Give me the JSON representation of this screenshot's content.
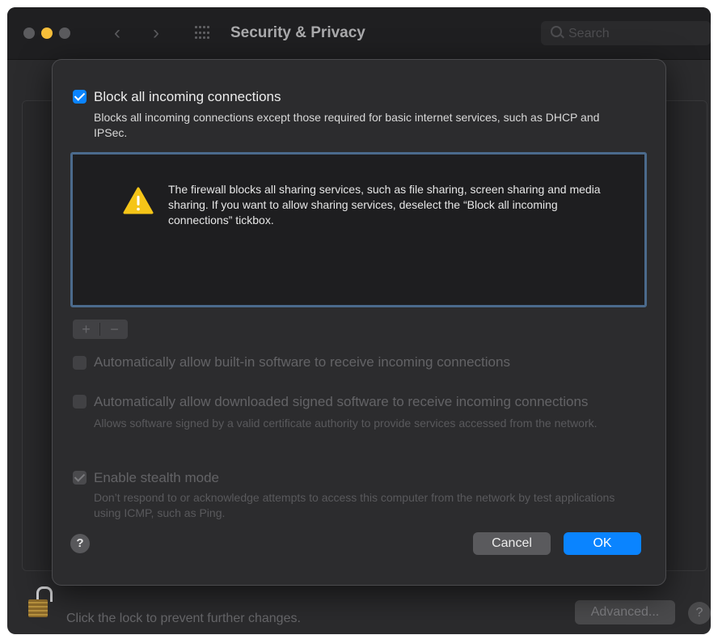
{
  "window": {
    "title": "Security & Privacy",
    "back_glyph": "‹",
    "forward_glyph": "›",
    "search_placeholder": "Search"
  },
  "footer": {
    "lock_text": "Click the lock to prevent further changes.",
    "advanced_label": "Advanced...",
    "help_label": "?"
  },
  "sheet": {
    "block_all": {
      "checked": true,
      "label": "Block all incoming connections",
      "description": "Blocks all incoming connections except those required for basic internet services, such as DHCP and IPSec."
    },
    "warning": {
      "icon": "warning-triangle-icon",
      "text": "The firewall blocks all sharing services, such as file sharing, screen sharing and media sharing. If you want to allow sharing services, deselect the “Block all incoming connections” tickbox."
    },
    "add_label": "+",
    "remove_label": "−",
    "auto_builtin": {
      "checked": false,
      "label": "Automatically allow built-in software to receive incoming connections"
    },
    "auto_signed": {
      "checked": false,
      "label": "Automatically allow downloaded signed software to receive incoming connections",
      "description": "Allows software signed by a valid certificate authority to provide services accessed from the network."
    },
    "stealth": {
      "checked": true,
      "label": "Enable stealth mode",
      "description": "Don’t respond to or acknowledge attempts to access this computer from the network by test applications using ICMP, such as Ping."
    },
    "help_label": "?",
    "cancel_label": "Cancel",
    "ok_label": "OK"
  },
  "colors": {
    "accent": "#0a84ff",
    "traffic_light_yellow": "#f6be3a",
    "warning_yellow": "#f5c518"
  }
}
